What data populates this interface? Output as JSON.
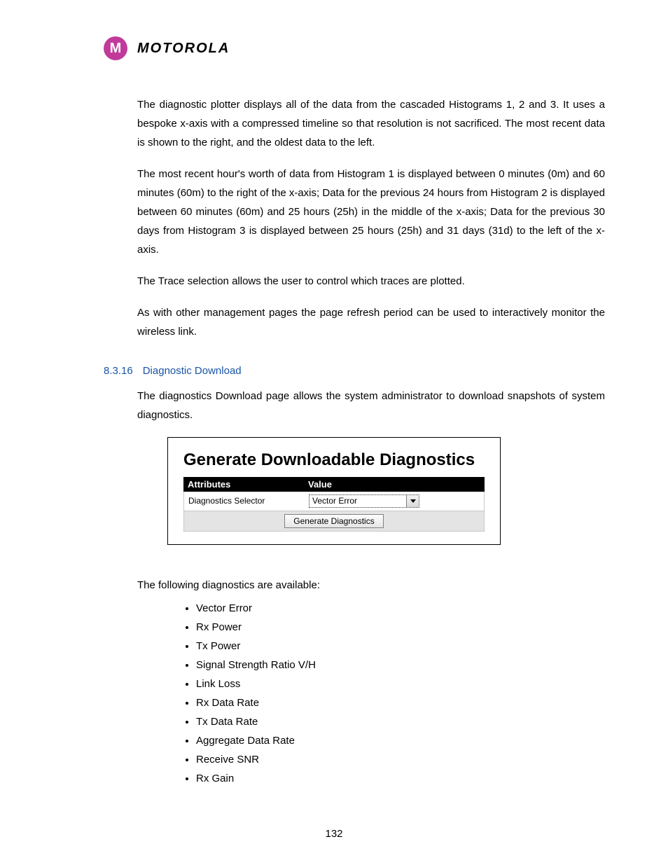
{
  "brand": "MOTOROLA",
  "paragraphs": {
    "p1": "The diagnostic plotter displays all of the data from the cascaded Histograms 1, 2 and 3. It uses a bespoke x-axis with a compressed timeline so that resolution is not sacrificed. The most recent data is shown to the right, and the oldest data to the left.",
    "p2": "The most recent hour's worth of data from Histogram 1 is displayed between 0 minutes (0m) and 60 minutes (60m) to the right of the x-axis;  Data for the previous 24 hours from Histogram 2 is displayed between 60 minutes (60m) and 25 hours (25h) in the middle of the x-axis; Data for the previous 30 days from Histogram 3 is displayed between 25 hours (25h) and 31 days (31d) to the left of the x-axis.",
    "p3": "The Trace selection allows the user to control which traces are plotted.",
    "p4": "As with other management pages the page refresh period can be used to interactively monitor the wireless link."
  },
  "section": {
    "num": "8.3.16",
    "title": "Diagnostic Download",
    "intro": "The diagnostics Download page allows the system administrator to download snapshots of system diagnostics."
  },
  "panel": {
    "title": "Generate Downloadable Diagnostics",
    "col1": "Attributes",
    "col2": "Value",
    "row_label": "Diagnostics Selector",
    "selected": "Vector Error",
    "button": "Generate Diagnostics"
  },
  "list_intro": "The following diagnostics are available:",
  "diagnostics": [
    "Vector Error",
    "Rx Power",
    "Tx Power",
    "Signal Strength Ratio V/H",
    "Link Loss",
    "Rx Data Rate",
    "Tx Data Rate",
    "Aggregate Data Rate",
    "Receive SNR",
    "Rx Gain"
  ],
  "page_number": "132"
}
